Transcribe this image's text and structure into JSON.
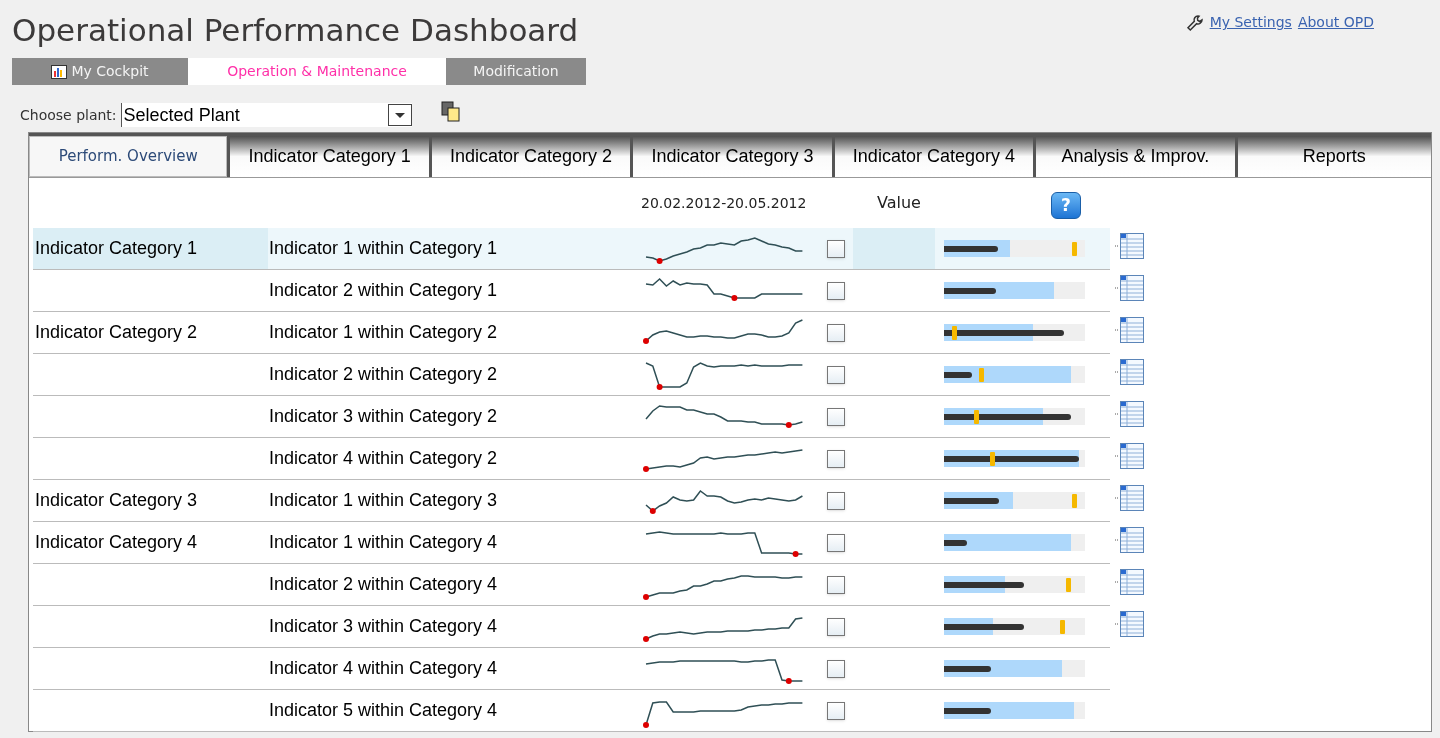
{
  "header": {
    "title": "Operational Performance Dashboard",
    "links": [
      {
        "label": "My Settings",
        "kind": "settings"
      },
      {
        "label": "About OPD",
        "kind": "plain"
      }
    ]
  },
  "nav_tabs": [
    {
      "label": "My Cockpit",
      "kind": "cockpit",
      "selected": false
    },
    {
      "label": "Operation & Maintenance",
      "kind": "plain",
      "selected": true
    },
    {
      "label": "Modification",
      "kind": "plain",
      "selected": false
    }
  ],
  "plant_selector": {
    "label": "Choose plant:",
    "value": "Selected Plant"
  },
  "section_tabs": [
    {
      "label": "Perform. Overview",
      "selected": true
    },
    {
      "label": "Indicator Category 1",
      "selected": false
    },
    {
      "label": "Indicator Category 2",
      "selected": false
    },
    {
      "label": "Indicator Category 3",
      "selected": false
    },
    {
      "label": "Indicator Category 4",
      "selected": false
    },
    {
      "label": "Analysis & Improv.",
      "selected": false
    },
    {
      "label": "Reports",
      "selected": false
    }
  ],
  "table": {
    "columns": {
      "period": "20.02.2012-20.05.2012",
      "value": "Value",
      "help": "?"
    },
    "rows": [
      {
        "category": "Indicator Category 1",
        "indicator": "Indicator 1 within Category 1",
        "selected": true,
        "checked": false,
        "range": {
          "level": 0.47
        },
        "actual": {
          "level": 0.38
        },
        "target": {
          "level": 0.92
        },
        "has_table": true
      },
      {
        "indicator": "Indicator 2 within Category 1",
        "selected": false,
        "checked": false,
        "range": {
          "level": 0.78
        },
        "actual": {
          "level": 0.37
        },
        "has_table": true
      },
      {
        "category": "Indicator Category 2",
        "indicator": "Indicator 1 within Category 2",
        "selected": false,
        "checked": false,
        "range": {
          "level": 0.63
        },
        "actual": {
          "level": 0.85
        },
        "target": {
          "level": 0.07
        },
        "has_table": true
      },
      {
        "indicator": "Indicator 2 within Category 2",
        "selected": false,
        "checked": false,
        "range": {
          "level": 0.9
        },
        "actual": {
          "level": 0.2
        },
        "target": {
          "level": 0.26
        },
        "has_table": true
      },
      {
        "indicator": "Indicator 3 within Category 2",
        "selected": false,
        "checked": false,
        "range": {
          "level": 0.7
        },
        "actual": {
          "level": 0.9
        },
        "target": {
          "level": 0.23
        },
        "has_table": true
      },
      {
        "indicator": "Indicator 4 within Category 2",
        "selected": false,
        "checked": false,
        "range": {
          "level": 0.96
        },
        "actual": {
          "level": 0.96
        },
        "target": {
          "level": 0.34
        },
        "has_table": true
      },
      {
        "category": "Indicator Category 3",
        "indicator": "Indicator 1 within Category 3",
        "selected": false,
        "checked": false,
        "range": {
          "level": 0.49
        },
        "actual": {
          "level": 0.39
        },
        "target": {
          "level": 0.92
        },
        "has_table": true
      },
      {
        "category": "Indicator Category 4",
        "indicator": "Indicator 1 within Category 4",
        "selected": false,
        "checked": false,
        "range": {
          "level": 0.9
        },
        "actual": {
          "level": 0.16
        },
        "has_table": true
      },
      {
        "indicator": "Indicator 2 within Category 4",
        "selected": false,
        "checked": false,
        "range": {
          "level": 0.43
        },
        "actual": {
          "level": 0.57
        },
        "target": {
          "level": 0.88
        },
        "has_table": true
      },
      {
        "indicator": "Indicator 3 within Category 4",
        "selected": false,
        "checked": false,
        "range": {
          "level": 0.35
        },
        "actual": {
          "level": 0.57
        },
        "target": {
          "level": 0.84
        },
        "has_table": true
      },
      {
        "indicator": "Indicator 4 within Category 4",
        "selected": false,
        "checked": false,
        "range": {
          "level": 0.84
        },
        "actual": {
          "level": 0.33
        },
        "has_table": false
      },
      {
        "indicator": "Indicator 5 within Category 4",
        "selected": false,
        "checked": false,
        "range": {
          "level": 0.92
        },
        "actual": {
          "level": 0.33
        },
        "has_table": false
      }
    ]
  }
}
